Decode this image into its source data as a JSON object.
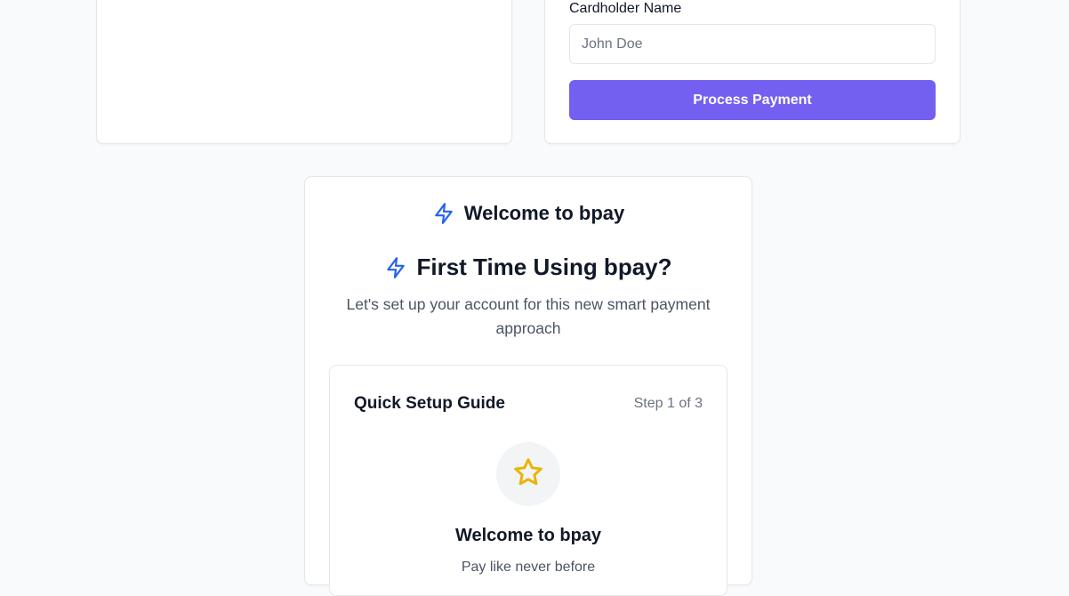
{
  "payment_form": {
    "cardholder_label": "Cardholder Name",
    "cardholder_placeholder": "John Doe",
    "cardholder_value": "",
    "submit_label": "Process Payment"
  },
  "onboarding": {
    "header_title": "Welcome to bpay",
    "heading": "First Time Using bpay?",
    "subtitle": "Let's set up your account for this new smart payment approach",
    "guide": {
      "title": "Quick Setup Guide",
      "step_indicator": "Step 1 of 3",
      "step_icon": "star-icon",
      "step_title": "Welcome to bpay",
      "step_description": "Pay like never before"
    }
  },
  "colors": {
    "accent_button": "#7360f0",
    "bolt_icon": "#2563eb",
    "star_icon": "#eab308",
    "page_background": "#f8fafc"
  }
}
